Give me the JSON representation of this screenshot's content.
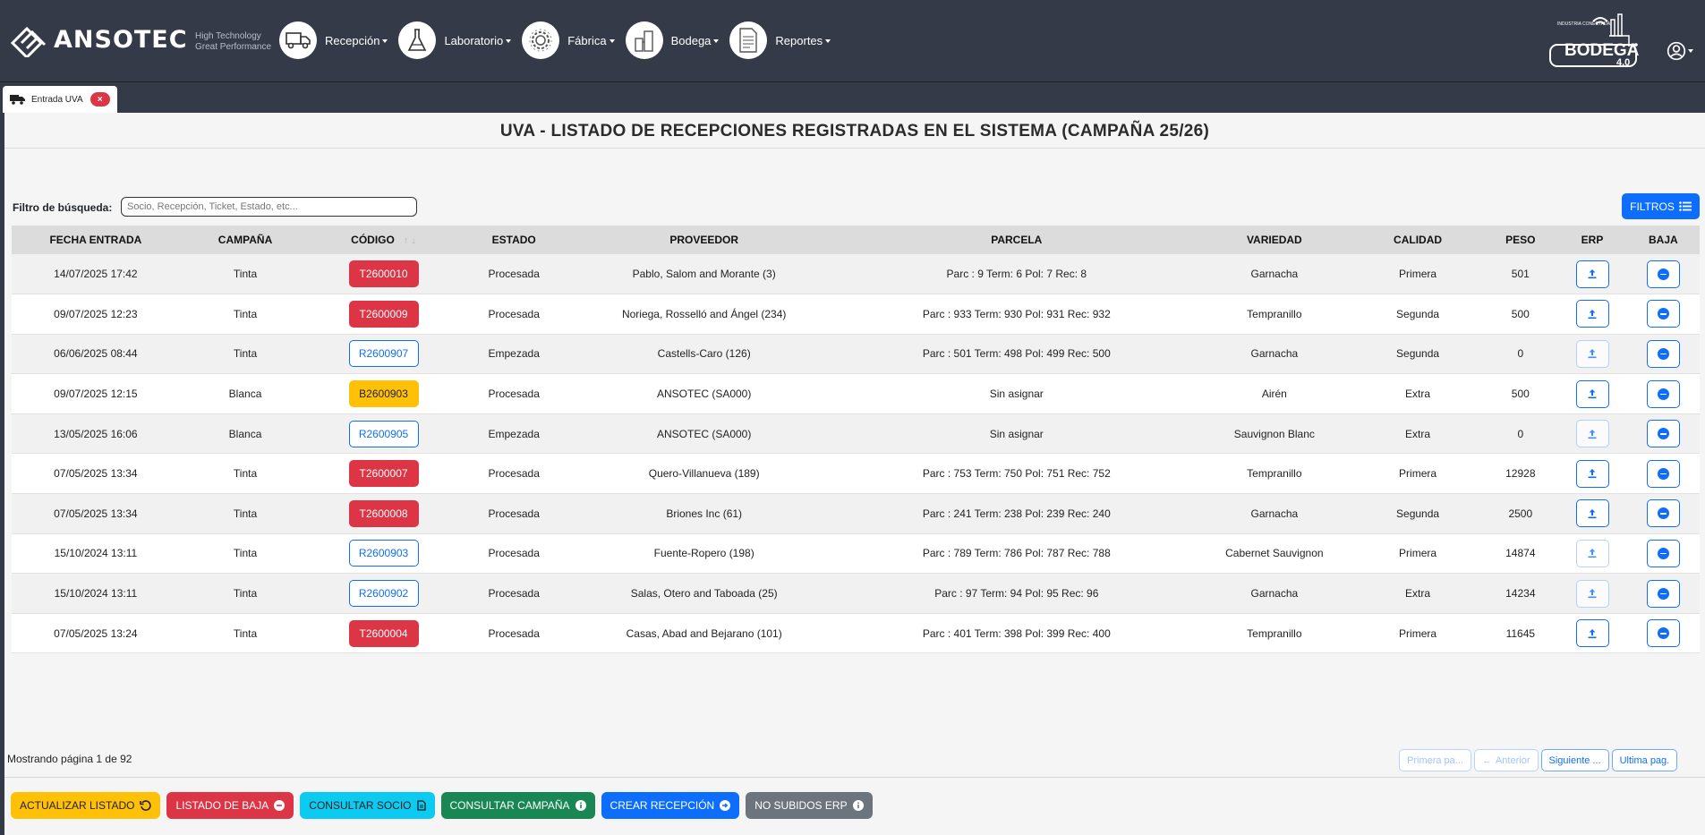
{
  "brand": {
    "name": "ANSOTEC",
    "tagline_1": "High Technology",
    "tagline_2": "Great Performance"
  },
  "nav": [
    {
      "label": "Recepción",
      "icon": "truck-icon"
    },
    {
      "label": "Laboratorio",
      "icon": "flask-icon"
    },
    {
      "label": "Fábrica",
      "icon": "gear-icon"
    },
    {
      "label": "Bodega",
      "icon": "tank-icon"
    },
    {
      "label": "Reportes",
      "icon": "document-icon"
    }
  ],
  "bodega_logo": {
    "top": "INDUSTRIA CONECTADA",
    "main": "BODEGA",
    "version": "4.0"
  },
  "tab": {
    "label": "Entrada UVA",
    "close": "×"
  },
  "page": {
    "title": "UVA - LISTADO DE RECEPCIONES REGISTRADAS EN EL SISTEMA (CAMPAÑA 25/26)",
    "filter_label": "Filtro de búsqueda:",
    "filter_placeholder": "Socio, Recepción, Ticket, Estado, etc...",
    "filtros_label": "FILTROS"
  },
  "table": {
    "headers": [
      "FECHA ENTRADA",
      "CAMPAÑA",
      "CÓDIGO",
      "ESTADO",
      "PROVEEDOR",
      "PARCELA",
      "VARIEDAD",
      "CALIDAD",
      "PESO",
      "ERP",
      "BAJA"
    ],
    "rows": [
      {
        "fecha": "14/07/2025 17:42",
        "campana": "Tinta",
        "codigo": "T2600010",
        "code_style": "red",
        "estado": "Procesada",
        "proveedor": "Pablo, Salom and Morante (3)",
        "parcela": "Parc : 9 Term: 6 Pol: 7 Rec: 8",
        "variedad": "Garnacha",
        "calidad": "Primera",
        "peso": "501",
        "erp_enabled": true
      },
      {
        "fecha": "09/07/2025 12:23",
        "campana": "Tinta",
        "codigo": "T2600009",
        "code_style": "red",
        "estado": "Procesada",
        "proveedor": "Noriega, Rosselló and Ángel (234)",
        "parcela": "Parc : 933 Term: 930 Pol: 931 Rec: 932",
        "variedad": "Tempranillo",
        "calidad": "Segunda",
        "peso": "500",
        "erp_enabled": true
      },
      {
        "fecha": "06/06/2025 08:44",
        "campana": "Tinta",
        "codigo": "R2600907",
        "code_style": "outline",
        "estado": "Empezada",
        "proveedor": "Castells-Caro (126)",
        "parcela": "Parc : 501 Term: 498 Pol: 499 Rec: 500",
        "variedad": "Garnacha",
        "calidad": "Segunda",
        "peso": "0",
        "erp_enabled": false
      },
      {
        "fecha": "09/07/2025 12:15",
        "campana": "Blanca",
        "codigo": "B2600903",
        "code_style": "yellow",
        "estado": "Procesada",
        "proveedor": "ANSOTEC (SA000)",
        "parcela": "Sin asignar",
        "variedad": "Airén",
        "calidad": "Extra",
        "peso": "500",
        "erp_enabled": true
      },
      {
        "fecha": "13/05/2025 16:06",
        "campana": "Blanca",
        "codigo": "R2600905",
        "code_style": "outline",
        "estado": "Empezada",
        "proveedor": "ANSOTEC (SA000)",
        "parcela": "Sin asignar",
        "variedad": "Sauvignon Blanc",
        "calidad": "Extra",
        "peso": "0",
        "erp_enabled": false
      },
      {
        "fecha": "07/05/2025 13:34",
        "campana": "Tinta",
        "codigo": "T2600007",
        "code_style": "red",
        "estado": "Procesada",
        "proveedor": "Quero-Villanueva (189)",
        "parcela": "Parc : 753 Term: 750 Pol: 751 Rec: 752",
        "variedad": "Tempranillo",
        "calidad": "Primera",
        "peso": "12928",
        "erp_enabled": true
      },
      {
        "fecha": "07/05/2025 13:34",
        "campana": "Tinta",
        "codigo": "T2600008",
        "code_style": "red",
        "estado": "Procesada",
        "proveedor": "Briones Inc (61)",
        "parcela": "Parc : 241 Term: 238 Pol: 239 Rec: 240",
        "variedad": "Garnacha",
        "calidad": "Segunda",
        "peso": "2500",
        "erp_enabled": true
      },
      {
        "fecha": "15/10/2024 13:11",
        "campana": "Tinta",
        "codigo": "R2600903",
        "code_style": "outline",
        "estado": "Procesada",
        "proveedor": "Fuente-Ropero (198)",
        "parcela": "Parc : 789 Term: 786 Pol: 787 Rec: 788",
        "variedad": "Cabernet Sauvignon",
        "calidad": "Primera",
        "peso": "14874",
        "erp_enabled": false
      },
      {
        "fecha": "15/10/2024 13:11",
        "campana": "Tinta",
        "codigo": "R2600902",
        "code_style": "outline",
        "estado": "Procesada",
        "proveedor": "Salas, Otero and Taboada (25)",
        "parcela": "Parc : 97 Term: 94 Pol: 95 Rec: 96",
        "variedad": "Garnacha",
        "calidad": "Extra",
        "peso": "14234",
        "erp_enabled": false
      },
      {
        "fecha": "07/05/2025 13:24",
        "campana": "Tinta",
        "codigo": "T2600004",
        "code_style": "red",
        "estado": "Procesada",
        "proveedor": "Casas, Abad and Bejarano (101)",
        "parcela": "Parc : 401 Term: 398 Pol: 399 Rec: 400",
        "variedad": "Tempranillo",
        "calidad": "Primera",
        "peso": "11645",
        "erp_enabled": true
      }
    ]
  },
  "pagination": {
    "info": "Mostrando página 1 de 92",
    "first": "Primera pa...",
    "prev": "Anterior",
    "next": "Siguiente ...",
    "last": "Ultima pag."
  },
  "actions": [
    {
      "label": "ACTUALIZAR LISTADO",
      "style": "a-yellow",
      "icon": "refresh-icon"
    },
    {
      "label": "LISTADO DE BAJA",
      "style": "a-red",
      "icon": "minus-circle-icon"
    },
    {
      "label": "CONSULTAR SOCIO",
      "style": "a-cyan",
      "icon": "file-icon"
    },
    {
      "label": "CONSULTAR CAMPAÑA",
      "style": "a-green",
      "icon": "info-icon"
    },
    {
      "label": "CREAR RECEPCIÓN",
      "style": "a-blue",
      "icon": "arrow-circle-icon"
    },
    {
      "label": "NO SUBIDOS ERP",
      "style": "a-gray",
      "icon": "info-icon"
    }
  ],
  "colors": {
    "nav_bg": "#343a48",
    "primary": "#0d6efd",
    "danger": "#dc3545",
    "warning": "#ffc107",
    "success": "#198754",
    "info": "#0dcaf0",
    "secondary": "#6c757d"
  }
}
